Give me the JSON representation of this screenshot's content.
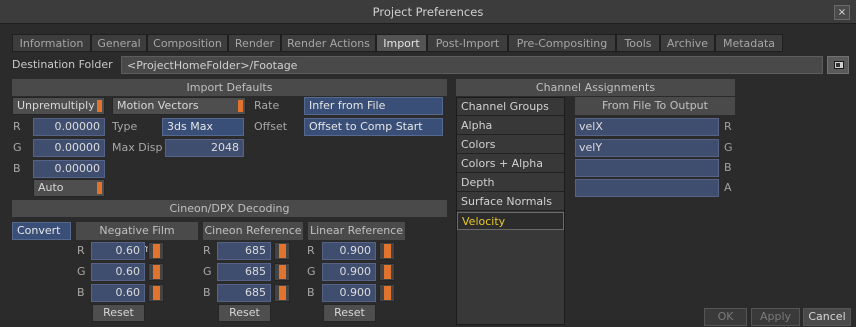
{
  "window": {
    "title": "Project Preferences",
    "close_glyph": "×"
  },
  "tabs": [
    {
      "label": "Information"
    },
    {
      "label": "General"
    },
    {
      "label": "Composition"
    },
    {
      "label": "Render"
    },
    {
      "label": "Render Actions"
    },
    {
      "label": "Import"
    },
    {
      "label": "Post-Import"
    },
    {
      "label": "Pre-Compositing"
    },
    {
      "label": "Tools"
    },
    {
      "label": "Archive"
    },
    {
      "label": "Metadata"
    }
  ],
  "active_tab": "Import",
  "destination": {
    "label": "Destination Folder",
    "value": "<ProjectHomeFolder>/Footage",
    "browse_icon": "folder-browse-icon"
  },
  "import_defaults": {
    "header": "Import Defaults",
    "unpremultiply": "Unpremultiply",
    "motion_vectors": "Motion Vectors",
    "rate_label": "Rate",
    "rate_value": "Infer from File",
    "r_label": "R",
    "r_value": "0.00000",
    "g_label": "G",
    "g_value": "0.00000",
    "b_label": "B",
    "b_value": "0.00000",
    "type_label": "Type",
    "type_value": "3ds Max",
    "offset_label": "Offset",
    "offset_value": "Offset to Comp Start",
    "maxdisp_label": "Max Disp",
    "maxdisp_value": "2048",
    "auto_label": "Auto"
  },
  "cineon": {
    "header": "Cineon/DPX Decoding",
    "convert": "Convert",
    "neg_gamma_header": "Negative Film Gamma",
    "cineon_ref_header": "Cineon Reference",
    "linear_ref_header": "Linear Reference",
    "r": "R",
    "g": "G",
    "b": "B",
    "neg_gamma": {
      "r": "0.60",
      "g": "0.60",
      "b": "0.60"
    },
    "cineon_ref": {
      "r": "685",
      "g": "685",
      "b": "685"
    },
    "linear_ref": {
      "r": "0.900",
      "g": "0.900",
      "b": "0.900"
    },
    "reset": "Reset"
  },
  "channels": {
    "header": "Channel Assignments",
    "groups_header": "Channel Groups",
    "groups": [
      "Alpha",
      "Colors",
      "Colors + Alpha",
      "Depth",
      "Surface Normals",
      "Velocity"
    ],
    "selected_group": "Velocity",
    "from_file_header": "From File To Output",
    "assignments": [
      {
        "value": "velX",
        "out": "R"
      },
      {
        "value": "velY",
        "out": "G"
      },
      {
        "value": "",
        "out": "B"
      },
      {
        "value": "",
        "out": "A"
      }
    ]
  },
  "footer": {
    "ok": "OK",
    "apply": "Apply",
    "cancel": "Cancel"
  }
}
